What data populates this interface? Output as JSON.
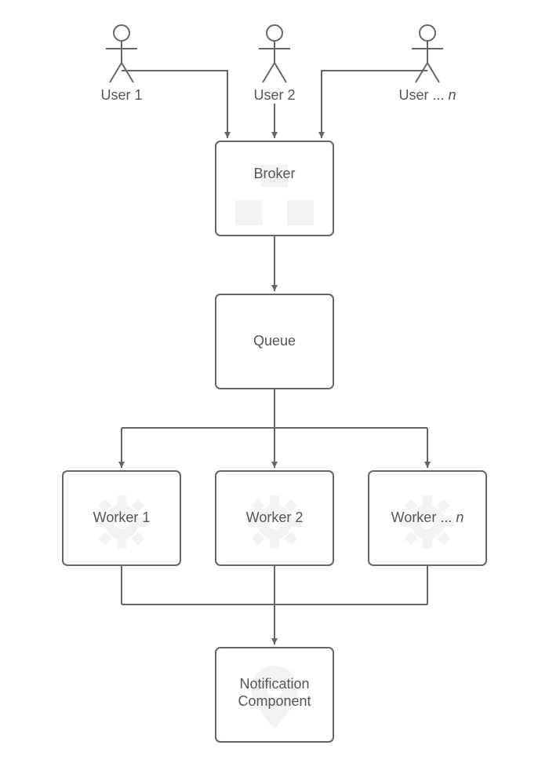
{
  "diagram": {
    "users": [
      {
        "label": "User 1"
      },
      {
        "label": "User 2"
      },
      {
        "label_prefix": "User ... ",
        "label_suffix": "n"
      }
    ],
    "broker": {
      "label": "Broker"
    },
    "queue": {
      "label": "Queue"
    },
    "workers": [
      {
        "label": "Worker 1"
      },
      {
        "label": "Worker 2"
      },
      {
        "label_prefix": "Worker ... ",
        "label_suffix": "n"
      }
    ],
    "notification": {
      "line1": "Notification",
      "line2": "Component"
    }
  }
}
